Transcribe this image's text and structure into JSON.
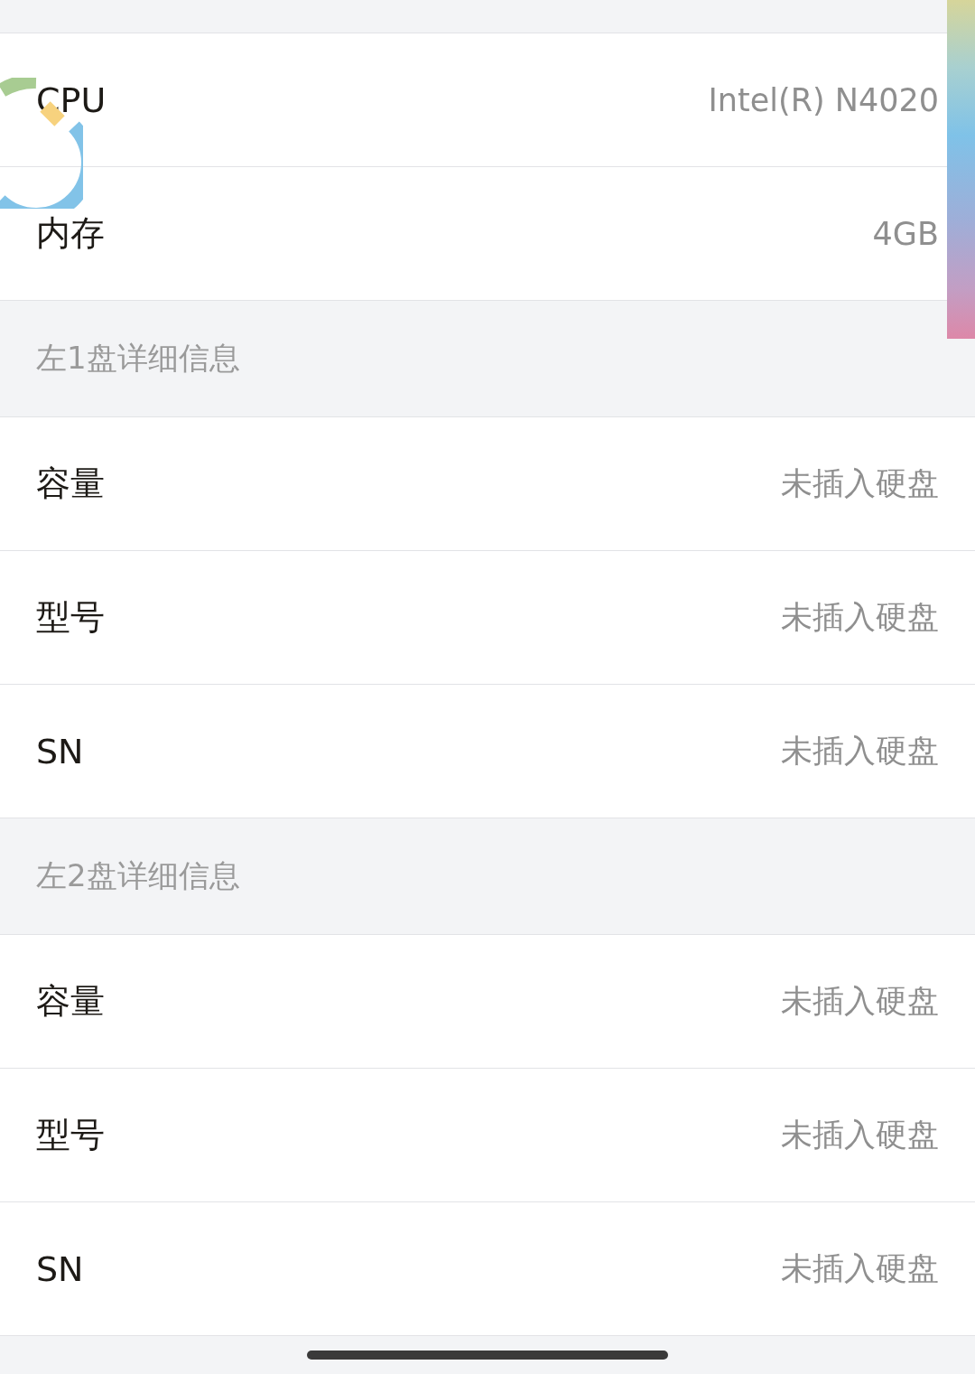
{
  "items": [
    {
      "kind": "row",
      "label": "CPU",
      "value": "Intel(R) N4020"
    },
    {
      "kind": "row",
      "label": "内存",
      "value": "4GB"
    },
    {
      "kind": "section",
      "label": "左1盘详细信息"
    },
    {
      "kind": "row",
      "label": "容量",
      "value": "未插入硬盘"
    },
    {
      "kind": "row",
      "label": "型号",
      "value": "未插入硬盘"
    },
    {
      "kind": "row",
      "label": "SN",
      "value": "未插入硬盘"
    },
    {
      "kind": "section",
      "label": "左2盘详细信息"
    },
    {
      "kind": "row",
      "label": "容量",
      "value": "未插入硬盘"
    },
    {
      "kind": "row",
      "label": "型号",
      "value": "未插入硬盘"
    },
    {
      "kind": "row",
      "label": "SN",
      "value": "未插入硬盘"
    }
  ]
}
